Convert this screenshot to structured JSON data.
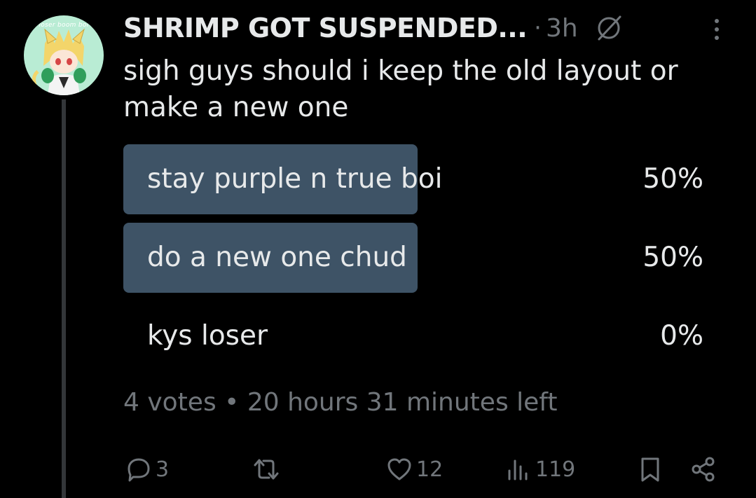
{
  "avatar": {
    "text": "loser boom boi"
  },
  "post": {
    "display_name": "SHRIMP GOT SUSPENDED...",
    "separator": "·",
    "time": "3h",
    "text": "sigh guys should i keep the old layout or make a new one"
  },
  "poll": {
    "options": [
      {
        "label": "stay purple n true boi",
        "percent_label": "50%",
        "percent": 50
      },
      {
        "label": "do a new one chud",
        "percent_label": "50%",
        "percent": 50
      },
      {
        "label": "kys loser",
        "percent_label": "0%",
        "percent": 0
      }
    ],
    "meta": "4 votes • 20 hours 31 minutes left"
  },
  "actions": {
    "replies": "3",
    "likes": "12",
    "views": "119"
  },
  "colors": {
    "background": "#000000",
    "text": "#e7e9ea",
    "secondary": "#71767b",
    "poll_bar": "#3e5366",
    "avatar_bg": "#b9ecd4"
  },
  "icons": [
    "verified-badge-icon",
    "more-icon",
    "reply-icon",
    "repost-icon",
    "like-icon",
    "views-icon",
    "bookmark-icon",
    "share-icon"
  ]
}
